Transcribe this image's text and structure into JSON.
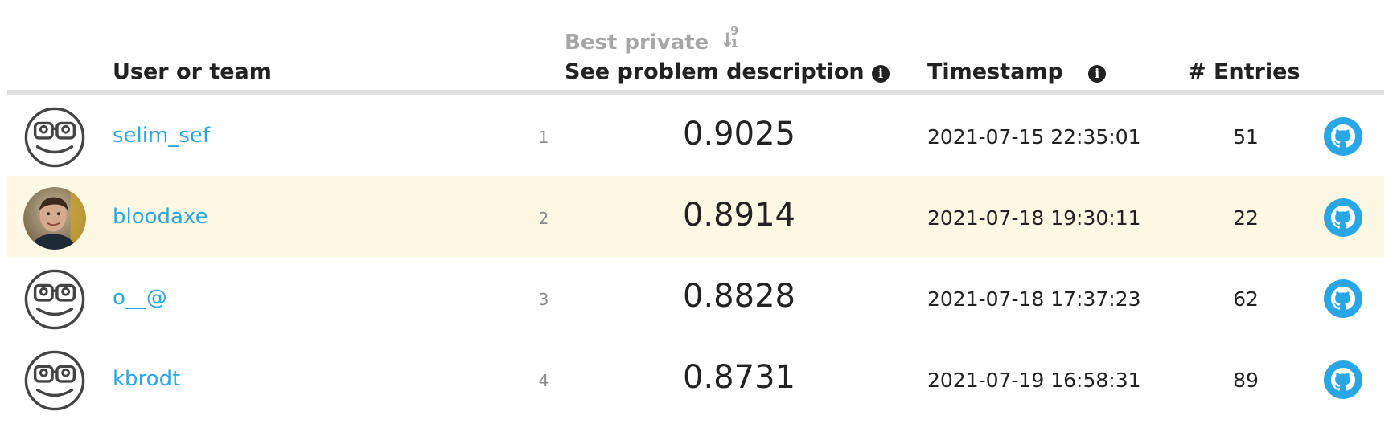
{
  "leaderboard": {
    "columns": {
      "user": "User or team",
      "sort_label": "Best private",
      "sort_icon": "sort-numeric-down-icon",
      "sort_icon_hi": "9",
      "sort_icon_lo": "1",
      "score": "See problem description",
      "timestamp": "Timestamp",
      "entries": "# Entries",
      "info_icon_glyph": "i"
    },
    "colors": {
      "link": "#29a6e6",
      "highlight_row": "#fdf8e3",
      "header_rule": "#dedede",
      "sort_label": "#a6a6a6"
    },
    "rows": [
      {
        "name": "selim_sef",
        "rank": "1",
        "score": "0.9025",
        "timestamp": "2021-07-15 22:35:01",
        "entries": "51",
        "avatar": "default-avatar-icon",
        "highlighted": false
      },
      {
        "name": "bloodaxe",
        "rank": "2",
        "score": "0.8914",
        "timestamp": "2021-07-18 19:30:11",
        "entries": "22",
        "avatar": "user-photo",
        "highlighted": true
      },
      {
        "name": "o__@",
        "rank": "3",
        "score": "0.8828",
        "timestamp": "2021-07-18 17:37:23",
        "entries": "62",
        "avatar": "default-avatar-icon",
        "highlighted": false
      },
      {
        "name": "kbrodt",
        "rank": "4",
        "score": "0.8731",
        "timestamp": "2021-07-19 16:58:31",
        "entries": "89",
        "avatar": "default-avatar-icon",
        "highlighted": false
      }
    ],
    "row_icon": "github-icon"
  }
}
